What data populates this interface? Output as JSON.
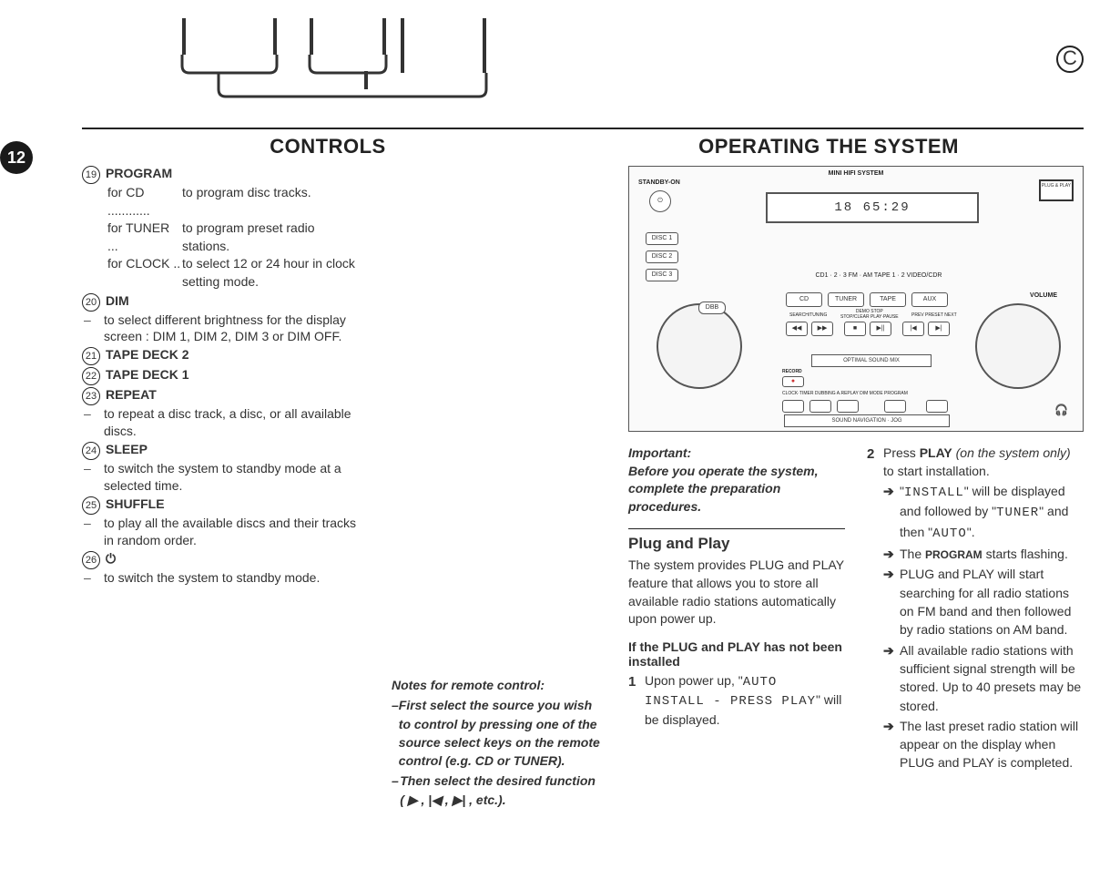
{
  "page_number": "12",
  "headers": {
    "left": "CONTROLS",
    "right": "OPERATING THE SYSTEM"
  },
  "top_diagram": {
    "label": "C"
  },
  "controls": {
    "item19": {
      "num": "19",
      "title": "PROGRAM",
      "rows": [
        {
          "k": "for CD ............",
          "v": "to program disc tracks."
        },
        {
          "k": "for TUNER ...",
          "v": "to program preset radio stations."
        },
        {
          "k": "for CLOCK ..",
          "v": "to select 12 or 24 hour in clock setting mode."
        }
      ]
    },
    "item20": {
      "num": "20",
      "title": "DIM",
      "dash": "to select different brightness for the display screen : DIM 1, DIM 2, DIM 3 or DIM OFF."
    },
    "item21": {
      "num": "21",
      "title": "TAPE DECK 2"
    },
    "item22": {
      "num": "22",
      "title": "TAPE DECK 1"
    },
    "item23": {
      "num": "23",
      "title": "REPEAT",
      "dash": "to repeat a disc track, a disc, or all available discs."
    },
    "item24": {
      "num": "24",
      "title": "SLEEP",
      "dash": "to switch the system to standby mode at a selected time."
    },
    "item25": {
      "num": "25",
      "title": "SHUFFLE",
      "dash": "to play all the available discs and their tracks in random order."
    },
    "item26": {
      "num": "26",
      "title": "⏻",
      "dash": "to switch the system to standby mode."
    }
  },
  "notes": {
    "head": "Notes for remote control:",
    "li1": "First select the source you wish to control by pressing one of the source select keys on the remote control (e.g.  CD or TUNER).",
    "li2": "Then select the desired function ( ▶ , |◀ , ▶| ,  etc.)."
  },
  "device": {
    "title": "MINI HIFI SYSTEM",
    "standby": "STANDBY-ON",
    "plugplay": "PLUG & PLAY",
    "disc1": "DISC 1",
    "disc2": "DISC 2",
    "disc3": "DISC 3",
    "display": "18  65:29",
    "srcrow": "CD1 · 2 · 3      FM · AM      TAPE 1 · 2      VIDEO/CDR",
    "btn_cd": "CD",
    "btn_tuner": "TUNER",
    "btn_tape": "TAPE",
    "btn_aux": "AUX",
    "volume": "VOLUME",
    "dbb": "DBB",
    "row2a": "SEARCH/TUNING",
    "row2b": "DEMO STOP\nSTOP/CLEAR PLAY·PAUSE",
    "row2c": "PREV PRESET NEXT",
    "osm": "OPTIMAL SOUND MIX",
    "record": "RECORD",
    "row4": "CLOCK·TIMER DUBBING A.REPLAY      DIM MODE      PROGRAM",
    "jog": "SOUND NAVIGATION · JOG",
    "t_prev": "◀◀",
    "t_next": "▶▶",
    "t_stop": "■",
    "t_play": "▶||",
    "t_pprev": "|◀",
    "t_pnext": "▶|"
  },
  "important": {
    "l1": "Important:",
    "l2": "Before you operate the system, complete the preparation procedures."
  },
  "plugplay": {
    "head": "Plug and Play",
    "p1": "The system provides PLUG and PLAY feature that allows you to store all available radio stations automatically upon power up.",
    "sub": "If the PLUG and PLAY has not been installed",
    "step1_pre": "Upon power up, \"",
    "step1_lcd": "AUTO INSTALL - PRESS PLAY",
    "step1_post": "\" will be displayed."
  },
  "rightcol": {
    "step2_pre": "Press ",
    "step2_bold": "PLAY",
    "step2_it": " (on the system only)",
    "step2_post": " to start installation.",
    "a1_pre": "\"",
    "a1_lcd1": "INSTALL",
    "a1_mid": "\" will be displayed and followed by \"",
    "a1_lcd2": "TUNER",
    "a1_mid2": "\" and then \"",
    "a1_lcd3": "AUTO",
    "a1_post": "\".",
    "a2_pre": "The ",
    "a2_bold": "PROGRAM",
    "a2_post": " starts flashing.",
    "a3": "PLUG and PLAY will start searching for all radio stations on FM band and then followed by radio stations on AM band.",
    "a4": "All available radio stations with sufficient signal strength will be stored. Up to 40 presets may be stored.",
    "a5": "The last preset radio station will appear on the display when PLUG and PLAY is completed."
  }
}
